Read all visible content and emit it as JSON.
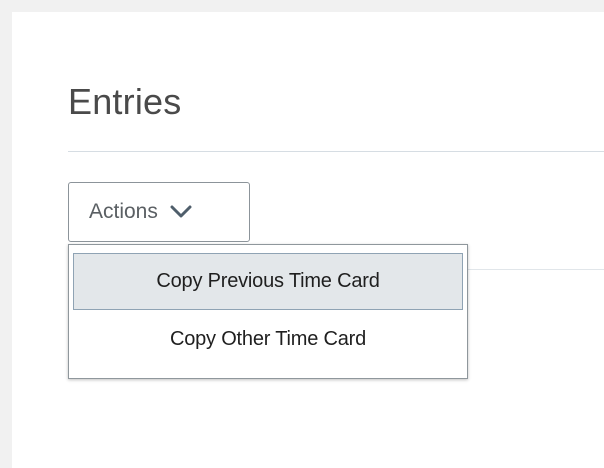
{
  "section": {
    "title": "Entries"
  },
  "actions_button": {
    "label": "Actions",
    "icon": "chevron-down-icon"
  },
  "actions_menu": {
    "items": [
      {
        "label": "Copy Previous Time Card",
        "state": "highlighted"
      },
      {
        "label": "Copy Other Time Card",
        "state": "normal"
      }
    ]
  },
  "colors": {
    "page_background": "#f1f1f1",
    "panel_background": "#ffffff",
    "title_text": "#4a4a4a",
    "menu_highlight": "#e3e7ea",
    "menu_highlight_border": "#8fa3b4"
  }
}
